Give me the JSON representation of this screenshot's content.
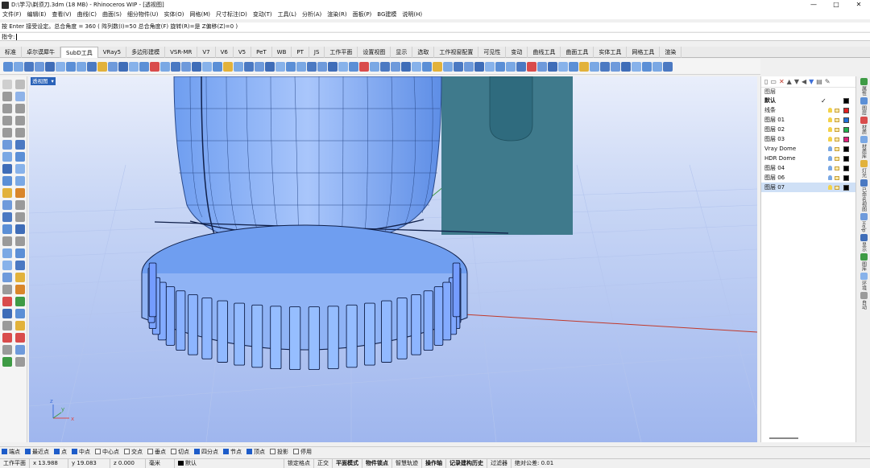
{
  "window": {
    "title": "D:\\学习\\剃须刀.3dm (18 MB) - Rhinoceros WIP - [透视图]",
    "controls": [
      "—",
      "□",
      "✕"
    ]
  },
  "menu": [
    "文件(F)",
    "编辑(E)",
    "查看(V)",
    "曲线(C)",
    "曲面(S)",
    "细分物件(U)",
    "实体(O)",
    "网格(M)",
    "尺寸标注(D)",
    "变动(T)",
    "工具(L)",
    "分析(A)",
    "渲染(R)",
    "面板(P)",
    "BG建模",
    "说明(H)"
  ],
  "command": {
    "history": "按 Enter 接受设定。总合角度 = 360 ( 阵列数(I)=50  总合角度(F)  旋转(R)=是  Z偏移(Z)=0 )",
    "prompt": "指令:"
  },
  "tabs": [
    {
      "label": "标准"
    },
    {
      "label": "卓尔谟犀牛"
    },
    {
      "label": "SubD工具",
      "active": true
    },
    {
      "label": "VRay5"
    },
    {
      "label": "多边形建模"
    },
    {
      "label": "VSR-MR"
    },
    {
      "label": "V7"
    },
    {
      "label": "V6"
    },
    {
      "label": "V5"
    },
    {
      "label": "PeT"
    },
    {
      "label": "WB"
    },
    {
      "label": "PT"
    },
    {
      "label": "JS"
    },
    {
      "label": "工作平面"
    },
    {
      "label": "设置视图"
    },
    {
      "label": "显示"
    },
    {
      "label": "选取"
    },
    {
      "label": "工作视窗配置"
    },
    {
      "label": "可见性"
    },
    {
      "label": "变动"
    },
    {
      "label": "曲线工具"
    },
    {
      "label": "曲面工具"
    },
    {
      "label": "实体工具"
    },
    {
      "label": "网格工具"
    },
    {
      "label": "渲染"
    }
  ],
  "viewport": {
    "name": "透视图",
    "axes": {
      "x": "x",
      "y": "y",
      "z": "z"
    }
  },
  "layers": {
    "header": "图层",
    "rows": [
      {
        "name": "默认",
        "current": true,
        "color": "#000000",
        "bold": true
      },
      {
        "name": "线条",
        "color": "#e02020"
      },
      {
        "name": "图层 01",
        "color": "#1e6fd8"
      },
      {
        "name": "图层 02",
        "color": "#22b14c"
      },
      {
        "name": "图层 03",
        "color": "#e0207a"
      },
      {
        "name": "Vray Dome",
        "color": "#000000"
      },
      {
        "name": "HDR Dome",
        "color": "#000000"
      },
      {
        "name": "图层 04",
        "color": "#000000"
      },
      {
        "name": "图层 06",
        "color": "#000000"
      },
      {
        "name": "图层 07",
        "color": "#000000",
        "selected": true
      }
    ]
  },
  "dock": [
    "属性",
    "图层",
    "材质",
    "材质库",
    "灯光",
    "已命名视图",
    "Help",
    "显示",
    "图库",
    "环境",
    "自动"
  ],
  "osnaps": [
    {
      "label": "端点",
      "on": true
    },
    {
      "label": "最近点",
      "on": true
    },
    {
      "label": "点",
      "on": true
    },
    {
      "label": "中点",
      "on": true
    },
    {
      "label": "中心点",
      "on": false
    },
    {
      "label": "交点",
      "on": false
    },
    {
      "label": "垂点",
      "on": false
    },
    {
      "label": "切点",
      "on": false
    },
    {
      "label": "四分点",
      "on": true
    },
    {
      "label": "节点",
      "on": true
    },
    {
      "label": "顶点",
      "on": true
    },
    {
      "label": "投影",
      "on": false
    },
    {
      "label": "停用",
      "on": false
    }
  ],
  "status": {
    "cplane": "工作平面",
    "x": "x 13.988",
    "y": "y 19.083",
    "z": "z 0.000",
    "units": "毫米",
    "layer": "默认",
    "toggles": [
      "锁定格点",
      "正交",
      "平面模式",
      "物件锁点",
      "智慧轨迹",
      "操作轴",
      "记录建构历史",
      "过滤器"
    ],
    "tolerance": "绝对公差: 0.01"
  }
}
